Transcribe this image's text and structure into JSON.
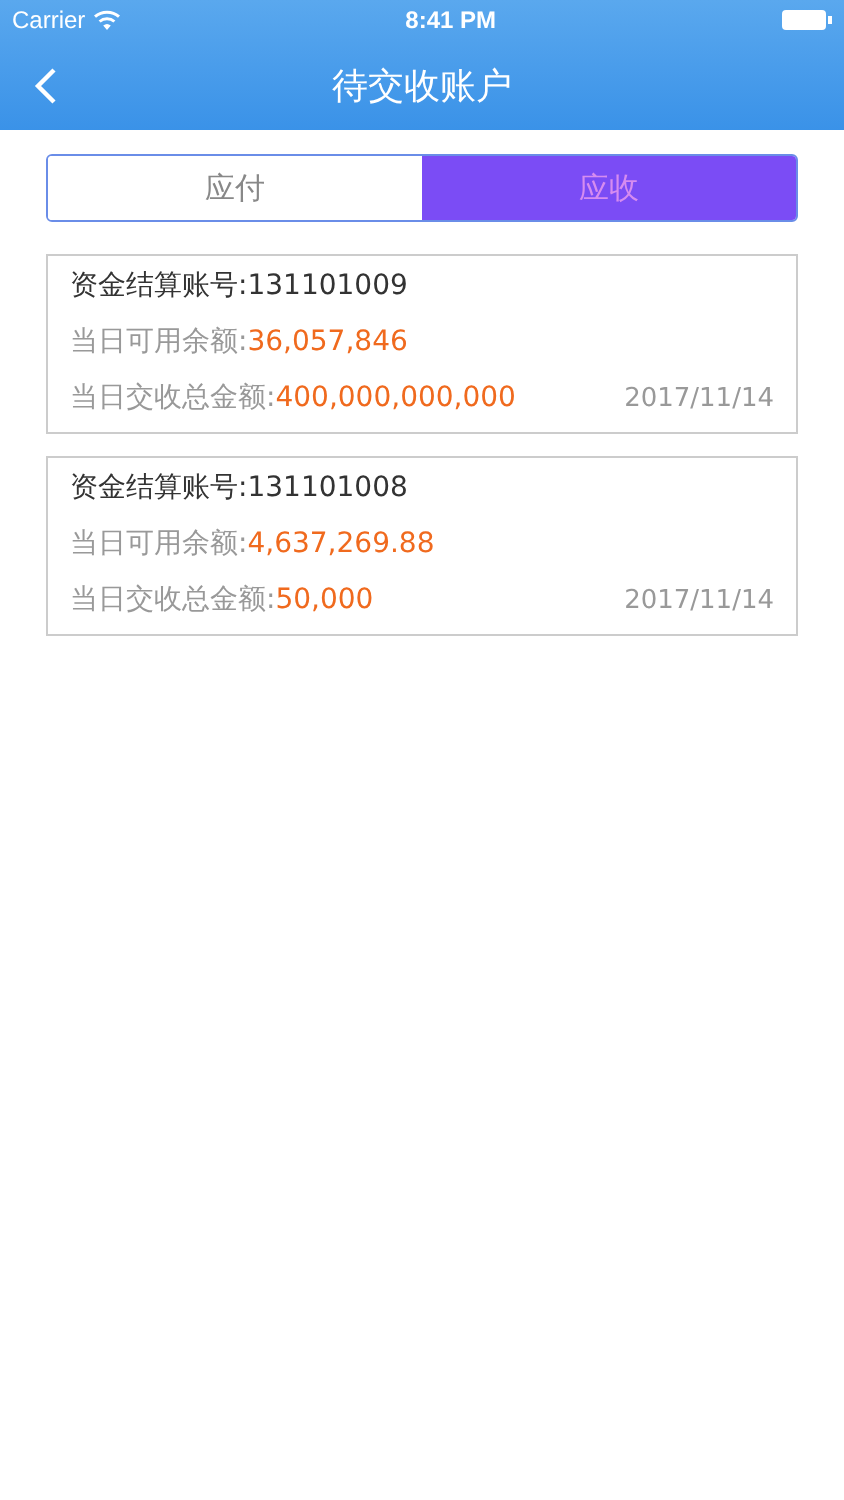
{
  "status_bar": {
    "carrier": "Carrier",
    "time": "8:41 PM"
  },
  "nav": {
    "title": "待交收账户"
  },
  "tabs": [
    {
      "label": "应付",
      "selected": false
    },
    {
      "label": "应收",
      "selected": true
    }
  ],
  "accounts": [
    {
      "account_label": "资金结算账号:",
      "account": "131101009",
      "available_label": "当日可用余额:",
      "available": "36,057,846",
      "total_label": "当日交收总金额:",
      "total": "400,000,000,000",
      "date": "2017/11/14"
    },
    {
      "account_label": "资金结算账号:",
      "account": "131101008",
      "available_label": "当日可用余额:",
      "available": "4,637,269.88",
      "total_label": "当日交收总金额:",
      "total": "50,000",
      "date": "2017/11/14"
    }
  ]
}
